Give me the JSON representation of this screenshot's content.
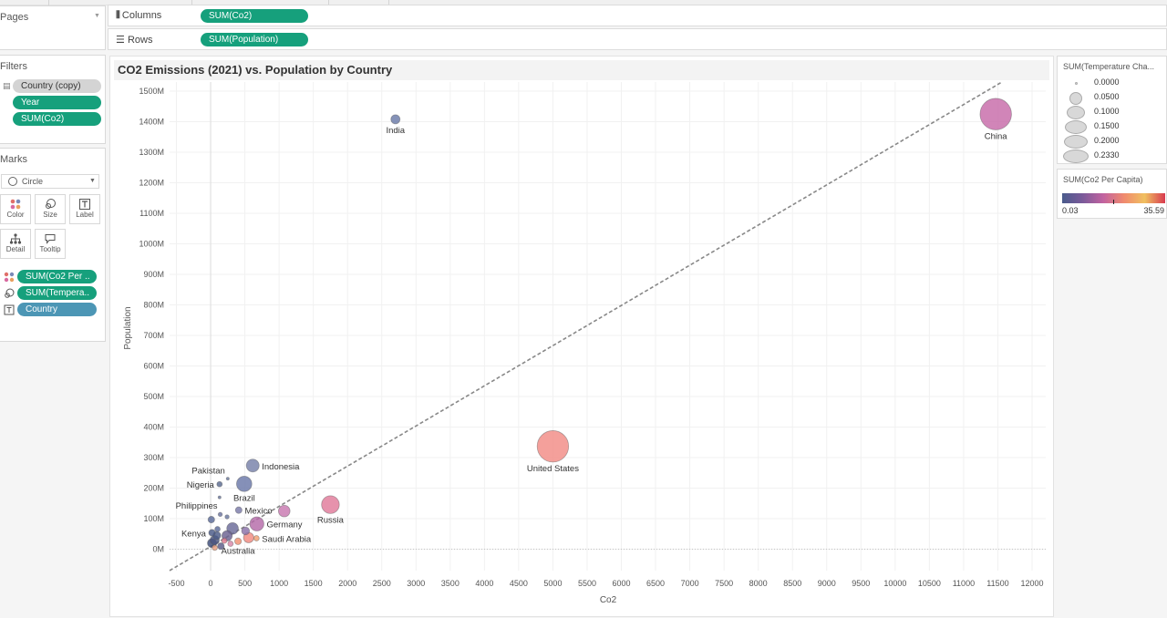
{
  "pages_panel": {
    "title": "Pages"
  },
  "filters_panel": {
    "title": "Filters",
    "items": [
      "Country (copy)",
      "Year",
      "SUM(Co2)"
    ]
  },
  "marks_panel": {
    "title": "Marks",
    "mark_type": "Circle",
    "buttons": [
      "Color",
      "Size",
      "Label",
      "Detail",
      "Tooltip"
    ],
    "fields": [
      "SUM(Co2 Per ..",
      "SUM(Tempera..",
      "Country"
    ]
  },
  "shelves": {
    "columns_label": "Columns",
    "columns_pill": "SUM(Co2)",
    "rows_label": "Rows",
    "rows_pill": "SUM(Population)"
  },
  "size_legend": {
    "title": "SUM(Temperature Cha...",
    "values": [
      "0.0000",
      "0.0500",
      "0.1000",
      "0.1500",
      "0.2000",
      "0.2330"
    ]
  },
  "color_legend": {
    "title": "SUM(Co2 Per Capita)",
    "min": "0.03",
    "max": "35.59",
    "colors": [
      "#4a5b8c",
      "#7b5a9a",
      "#c263a0",
      "#f08a6e",
      "#f0c060",
      "#d83a50"
    ]
  },
  "chart_data": {
    "type": "scatter",
    "title": "CO2 Emissions (2021) vs. Population by Country",
    "xlabel": "Co2",
    "ylabel": "Population",
    "xlim": [
      -600,
      12200
    ],
    "ylim": [
      -70,
      1530
    ],
    "x_ticks": [
      -500,
      0,
      500,
      1000,
      1500,
      2000,
      2500,
      3000,
      3500,
      4000,
      4500,
      5000,
      5500,
      6000,
      6500,
      7000,
      7500,
      8000,
      8500,
      9000,
      9500,
      10000,
      10500,
      11000,
      11500,
      12000
    ],
    "y_ticks": [
      0,
      100,
      200,
      300,
      400,
      500,
      600,
      700,
      800,
      900,
      1000,
      1100,
      1200,
      1300,
      1400,
      1500
    ],
    "y_tick_labels": [
      "0M",
      "100M",
      "200M",
      "300M",
      "400M",
      "500M",
      "600M",
      "700M",
      "800M",
      "900M",
      "1000M",
      "1100M",
      "1200M",
      "1300M",
      "1400M",
      "1500M"
    ],
    "trend_line": {
      "style": "dashed",
      "from": [
        -600,
        -70
      ],
      "to": [
        11560,
        1530
      ]
    },
    "points": [
      {
        "label": "China",
        "x": 11470,
        "y": 1425,
        "size": 0.23,
        "color": "#c76aa8"
      },
      {
        "label": "India",
        "x": 2700,
        "y": 1408,
        "size": 0.05,
        "color": "#6a7aa8"
      },
      {
        "label": "United States",
        "x": 5000,
        "y": 337,
        "size": 0.23,
        "color": "#f28b85"
      },
      {
        "label": "Russia",
        "x": 1750,
        "y": 146,
        "size": 0.12,
        "color": "#e07a9a"
      },
      {
        "label": "Indonesia",
        "x": 615,
        "y": 274,
        "size": 0.08,
        "color": "#7680a8"
      },
      {
        "label": "Pakistan",
        "x": 250,
        "y": 231,
        "size": 0.0,
        "color": "#6a7aa0"
      },
      {
        "label": "Nigeria",
        "x": 130,
        "y": 213,
        "size": 0.02,
        "color": "#5a6a90"
      },
      {
        "label": "Brazil",
        "x": 490,
        "y": 214,
        "size": 0.1,
        "color": "#6a78a8"
      },
      {
        "label": "Philippines",
        "x": 140,
        "y": 114,
        "size": 0.01,
        "color": "#6a74a0"
      },
      {
        "label": "Mexico",
        "x": 410,
        "y": 128,
        "size": 0.03,
        "color": "#7a7aa8"
      },
      {
        "label": "",
        "x": 1075,
        "y": 125,
        "size": 0.07,
        "color": "#c878b0"
      },
      {
        "label": "Germany",
        "x": 675,
        "y": 83,
        "size": 0.09,
        "color": "#b46aa8"
      },
      {
        "label": "Kenya",
        "x": 20,
        "y": 54,
        "size": 0.03,
        "color": "#4a5a88"
      },
      {
        "label": "Saudi Arabia",
        "x": 670,
        "y": 36,
        "size": 0.02,
        "color": "#f0a070"
      },
      {
        "label": "",
        "x": 555,
        "y": 38,
        "size": 0.06,
        "color": "#f28a80"
      },
      {
        "label": "Australia",
        "x": 400,
        "y": 26,
        "size": 0.03,
        "color": "#f09070"
      },
      {
        "label": "",
        "x": 320,
        "y": 68,
        "size": 0.07,
        "color": "#6a6a98"
      },
      {
        "label": "",
        "x": 240,
        "y": 44,
        "size": 0.06,
        "color": "#6a6090"
      },
      {
        "label": "",
        "x": 90,
        "y": 45,
        "size": 0.04,
        "color": "#4a5a88"
      },
      {
        "label": "",
        "x": 20,
        "y": 20,
        "size": 0.05,
        "color": "#3a4a78"
      },
      {
        "label": "",
        "x": 60,
        "y": 30,
        "size": 0.05,
        "color": "#4a5480"
      },
      {
        "label": "",
        "x": 200,
        "y": 28,
        "size": 0.02,
        "color": "#e07a90"
      },
      {
        "label": "",
        "x": 290,
        "y": 18,
        "size": 0.02,
        "color": "#d888a8"
      },
      {
        "label": "",
        "x": 150,
        "y": 10,
        "size": 0.03,
        "color": "#5a5a88"
      },
      {
        "label": "",
        "x": 510,
        "y": 60,
        "size": 0.04,
        "color": "#8a70a8"
      },
      {
        "label": "",
        "x": 100,
        "y": 66,
        "size": 0.02,
        "color": "#5a6a98"
      },
      {
        "label": "",
        "x": 10,
        "y": 97,
        "size": 0.03,
        "color": "#5a6a98"
      },
      {
        "label": "",
        "x": 240,
        "y": 106,
        "size": 0.01,
        "color": "#6a78a0"
      },
      {
        "label": "",
        "x": 130,
        "y": 170,
        "size": 0.0,
        "color": "#6a78a0"
      },
      {
        "label": "",
        "x": 60,
        "y": 5,
        "size": 0.02,
        "color": "#e8a080"
      }
    ]
  }
}
